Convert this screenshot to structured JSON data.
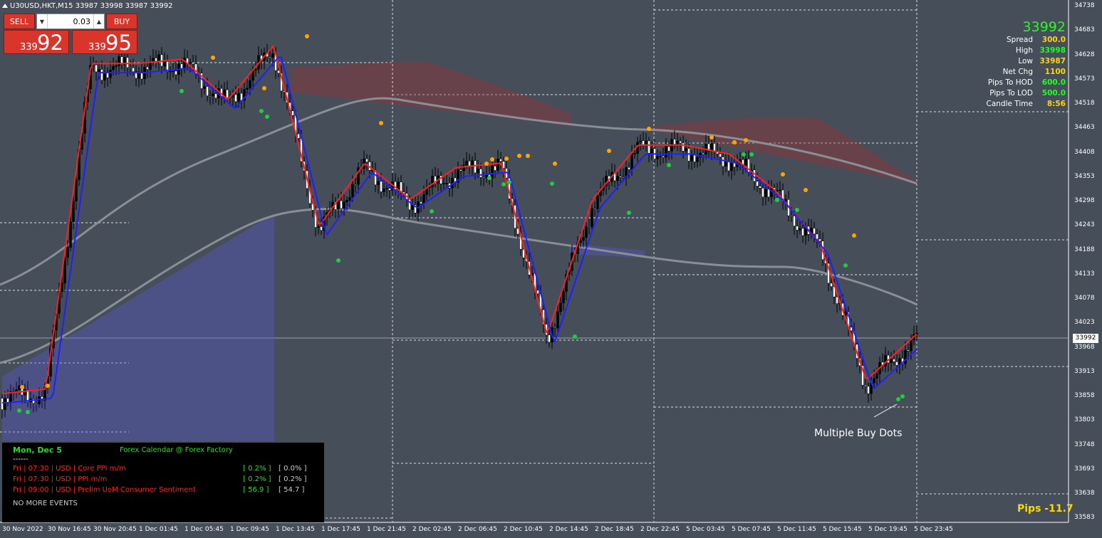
{
  "window": {
    "title": "U30USD,HKT,M15  33987 33998 33987 33992"
  },
  "trade_panel": {
    "sell_label": "SELL",
    "buy_label": "BUY",
    "lot_value": "0.03",
    "sell_prefix": "339",
    "sell_big": "92",
    "buy_prefix": "339",
    "buy_big": "95"
  },
  "info_panel": {
    "price": "33992",
    "rows": [
      {
        "label": "Spread",
        "value": "300.0",
        "color": "#ffd700"
      },
      {
        "label": "High",
        "value": "33998",
        "color": "#20ff20"
      },
      {
        "label": "Low",
        "value": "33987",
        "color": "#ffd700"
      },
      {
        "label": "Net Chg",
        "value": "1100",
        "color": "#ffd700"
      },
      {
        "label": "Pips To HOD",
        "value": "600.0",
        "color": "#20ff20"
      },
      {
        "label": "Pips To LOD",
        "value": "500.0",
        "color": "#20ff20"
      },
      {
        "label": "Candle Time",
        "value": "8:56",
        "color": "#ffd700"
      }
    ]
  },
  "calendar": {
    "date": "Mon, Dec 5",
    "header": "Forex Calendar @ Forex Factory",
    "dashes": "------",
    "events": [
      {
        "text": "Fri  |  07:30  |  USD  |  Core PPI m/m",
        "actual": "[ 0.2% ]",
        "previous": "[ 0.0% ]"
      },
      {
        "text": "Fri  |  07:30  |  USD  |  PPI m/m",
        "actual": "[ 0.2% ]",
        "previous": "[ 0.2% ]"
      },
      {
        "text": "Fri  |  09:00  |  USD  |  Prelim UoM Consumer Sentiment",
        "actual": "[ 56.9 ]",
        "previous": "[ 54.7 ]"
      }
    ],
    "footer": "NO MORE EVENTS"
  },
  "annotation": "Multiple Buy Dots",
  "pips_label": "Pips -11.7",
  "current_price_tag": "33992",
  "y_axis": [
    "34738",
    "34683",
    "34628",
    "34573",
    "34518",
    "34463",
    "34408",
    "34353",
    "34298",
    "34243",
    "34188",
    "34133",
    "34078",
    "34023",
    "33968",
    "33913",
    "33858",
    "33803",
    "33748",
    "33693",
    "33638",
    "33583"
  ],
  "x_axis": [
    "30 Nov 2022",
    "30 Nov 16:45",
    "30 Nov 20:45",
    "1 Dec 01:45",
    "1 Dec 05:45",
    "1 Dec 09:45",
    "1 Dec 13:45",
    "1 Dec 17:45",
    "1 Dec 21:45",
    "2 Dec 02:45",
    "2 Dec 06:45",
    "2 Dec 10:45",
    "2 Dec 14:45",
    "2 Dec 18:45",
    "2 Dec 22:45",
    "5 Dec 03:45",
    "5 Dec 07:45",
    "5 Dec 11:45",
    "5 Dec 15:45",
    "5 Dec 19:45",
    "5 Dec 23:45"
  ],
  "colors": {
    "background": "#454e59",
    "bull_candle": "#000000",
    "fast_ma": "#ff2020",
    "slow_ma": "#2020ff",
    "long_ma": "#8a8f95",
    "cloud_bear": "#a03030",
    "cloud_bull": "#5a5ad0",
    "buy_dot": "#20cc40",
    "sell_dot": "#ffa500"
  },
  "chart_data": {
    "type": "candlestick",
    "symbol": "U30USD",
    "timeframe": "M15",
    "ylim": [
      33583,
      34738
    ],
    "close_path": [
      [
        "30 Nov 2022",
        33870
      ],
      [
        "30 Nov 16:45",
        33880
      ],
      [
        "30 Nov 20:45",
        34600
      ],
      [
        "1 Dec 01:45",
        34600
      ],
      [
        "1 Dec 05:45",
        34610
      ],
      [
        "1 Dec 09:45",
        34520
      ],
      [
        "1 Dec 13:45",
        34640
      ],
      [
        "1 Dec 17:45",
        34240
      ],
      [
        "1 Dec 21:45",
        34380
      ],
      [
        "2 Dec 02:45",
        34300
      ],
      [
        "2 Dec 06:45",
        34370
      ],
      [
        "2 Dec 10:45",
        34380
      ],
      [
        "2 Dec 14:45",
        34000
      ],
      [
        "2 Dec 18:45",
        34300
      ],
      [
        "2 Dec 22:45",
        34420
      ],
      [
        "5 Dec 03:45",
        34420
      ],
      [
        "5 Dec 07:45",
        34400
      ],
      [
        "5 Dec 11:45",
        34320
      ],
      [
        "5 Dec 15:45",
        34200
      ],
      [
        "5 Dec 19:45",
        33900
      ],
      [
        "5 Dec 23:45",
        33992
      ]
    ]
  }
}
